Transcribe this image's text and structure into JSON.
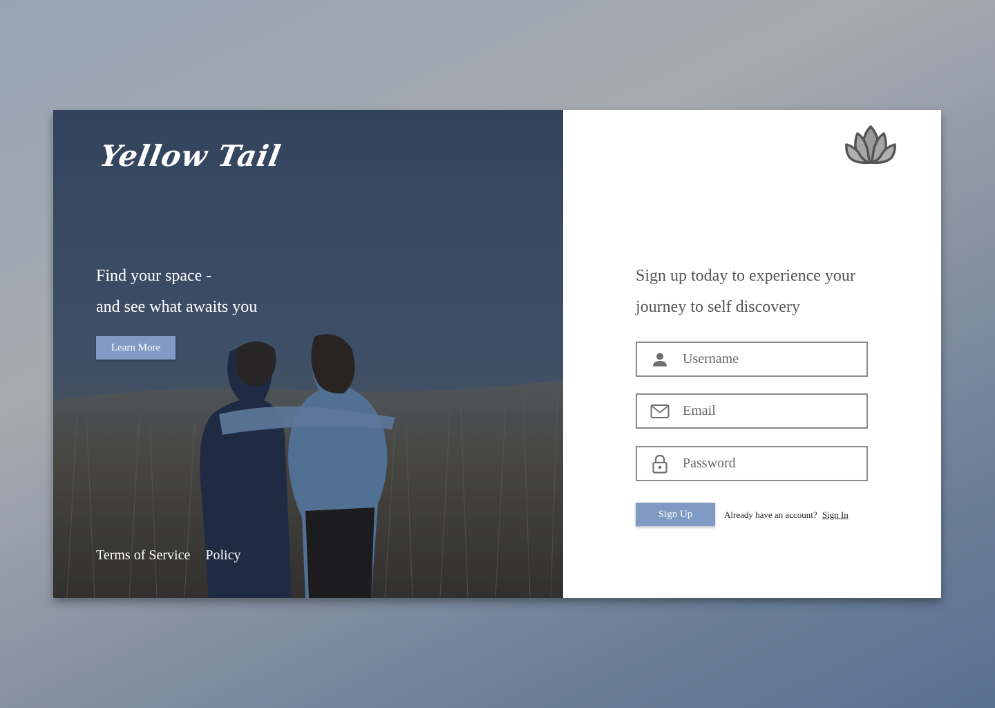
{
  "brand": {
    "name": "Yellow Tail"
  },
  "hero": {
    "tagline_line1": "Find your space -",
    "tagline_line2": "and see what awaits you",
    "learn_more_label": "Learn More"
  },
  "footer": {
    "terms_label": "Terms of Service",
    "policy_label": "Policy"
  },
  "signup": {
    "headline_line1": "Sign up today to experience your",
    "headline_line2": "journey to self discovery",
    "username_placeholder": "Username",
    "email_placeholder": "Email",
    "password_placeholder": "Password",
    "submit_label": "Sign Up",
    "account_prompt": "Already have an account?",
    "signin_label": "Sign In"
  },
  "colors": {
    "accent": "#7f9bc4",
    "text_muted": "#555555",
    "border": "#8a8a8a"
  },
  "icons": {
    "logo": "lotus-icon",
    "username": "person-icon",
    "email": "envelope-icon",
    "password": "lock-icon"
  }
}
